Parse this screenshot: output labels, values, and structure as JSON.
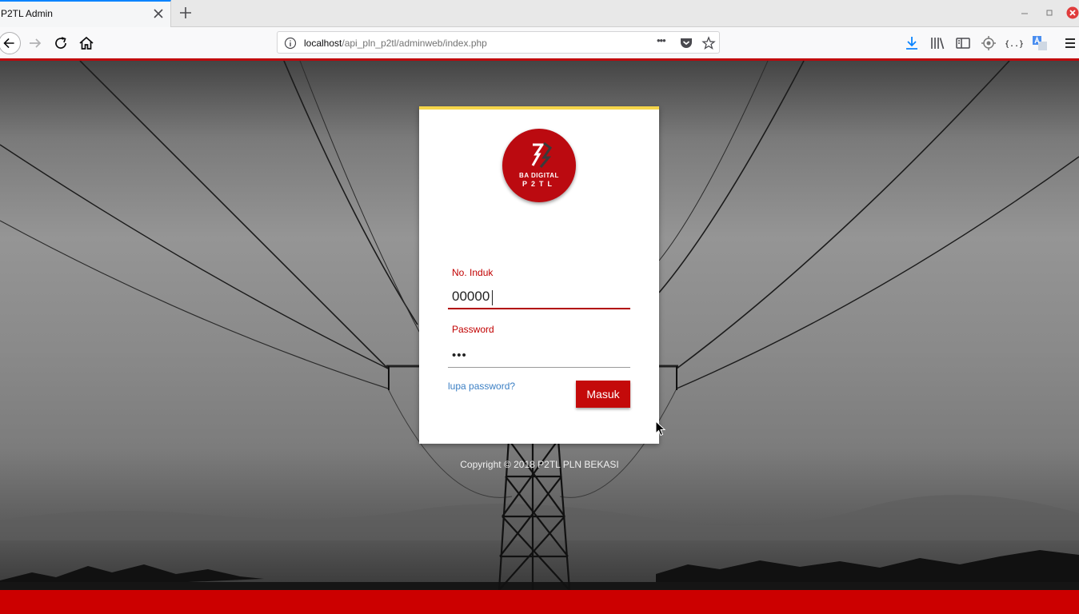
{
  "browser": {
    "tab_title": "P2TL Admin",
    "url_host": "localhost",
    "url_path": "/api_pln_p2tl/adminweb/index.php",
    "page_actions_label": "•••",
    "accent_color": "#0a84ff"
  },
  "login": {
    "logo_line1": "BA DIGITAL",
    "logo_line2": "P2TL",
    "induk_label": "No. Induk",
    "induk_value": "00000",
    "password_label": "Password",
    "password_value": "•••",
    "forgot_label": "lupa password?",
    "submit_label": "Masuk",
    "brand_color": "#c40a0a",
    "top_border_color": "#f5d54a"
  },
  "footer": {
    "copyright": "Copyright © 2018 P2TL PLN BEKASI",
    "bar_color": "#cc0000"
  }
}
